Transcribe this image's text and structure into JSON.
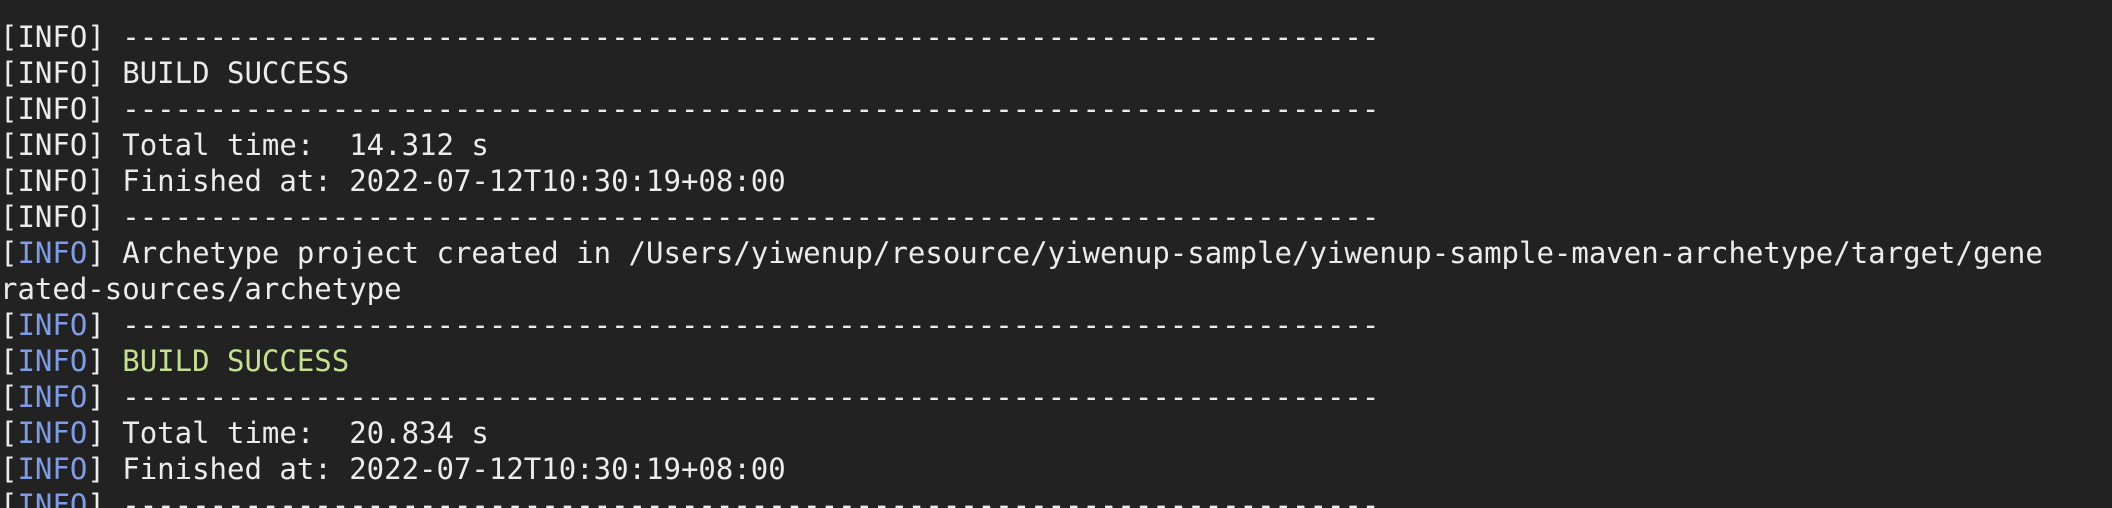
{
  "colors": {
    "background": "#222222",
    "text": "#ececec",
    "info_level": "#7f9de6",
    "success": "#c5e08e"
  },
  "lines": [
    {
      "level": "",
      "level_colored": false,
      "text": "  [ ]   [ ]    [ ]      [ ]          [ ]          [ ]       [ ]      [ ]",
      "style": "clipped"
    },
    {
      "level": "INFO",
      "level_colored": false,
      "text": "------------------------------------------------------------------------",
      "style": "plain"
    },
    {
      "level": "INFO",
      "level_colored": false,
      "text": "BUILD SUCCESS",
      "style": "plain"
    },
    {
      "level": "INFO",
      "level_colored": false,
      "text": "------------------------------------------------------------------------",
      "style": "plain"
    },
    {
      "level": "INFO",
      "level_colored": false,
      "text": "Total time:  14.312 s",
      "style": "plain"
    },
    {
      "level": "INFO",
      "level_colored": false,
      "text": "Finished at: 2022-07-12T10:30:19+08:00",
      "style": "plain"
    },
    {
      "level": "INFO",
      "level_colored": false,
      "text": "------------------------------------------------------------------------",
      "style": "plain"
    },
    {
      "level": "INFO",
      "level_colored": true,
      "text": "Archetype project created in /Users/yiwenup/resource/yiwenup-sample/yiwenup-sample-maven-archetype/target/gene",
      "style": "plain"
    },
    {
      "level": "",
      "level_colored": false,
      "text": "rated-sources/archetype",
      "style": "continuation"
    },
    {
      "level": "INFO",
      "level_colored": true,
      "text": "------------------------------------------------------------------------",
      "style": "plain"
    },
    {
      "level": "INFO",
      "level_colored": true,
      "text": "BUILD SUCCESS",
      "style": "success"
    },
    {
      "level": "INFO",
      "level_colored": true,
      "text": "------------------------------------------------------------------------",
      "style": "plain"
    },
    {
      "level": "INFO",
      "level_colored": true,
      "text": "Total time:  20.834 s",
      "style": "plain"
    },
    {
      "level": "INFO",
      "level_colored": true,
      "text": "Finished at: 2022-07-12T10:30:19+08:00",
      "style": "plain"
    },
    {
      "level": "INFO",
      "level_colored": true,
      "text": "------------------------------------------------------------------------",
      "style": "plain"
    }
  ]
}
